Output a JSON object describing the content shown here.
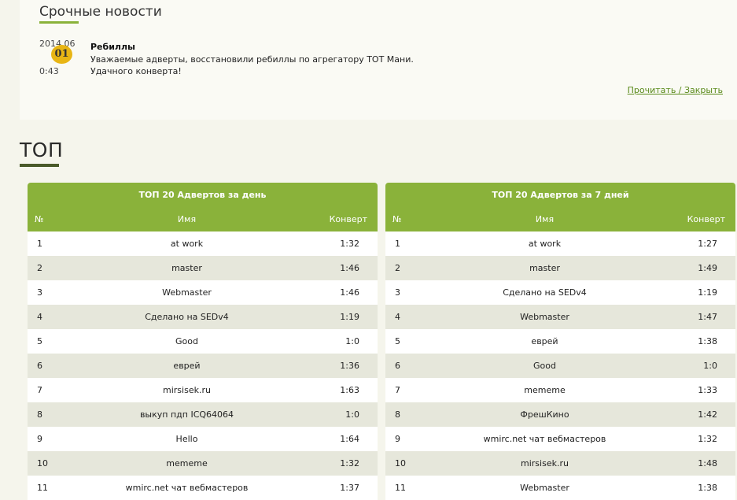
{
  "news": {
    "title": "Срочные новости",
    "date_top": "2014.06",
    "day": "01",
    "time": "0:43",
    "headline": "Ребиллы",
    "text_line1": "Уважаемые адверты, восстановили ребиллы по агрегатору ТОТ Мани.",
    "text_line2": "Удачного конверта!",
    "link": "Прочитать / Закрыть"
  },
  "top": {
    "title": "ТОП",
    "left": {
      "title": "ТОП 20 Адвертов за день",
      "col_num": "№",
      "col_name": "Имя",
      "col_conv": "Конверт",
      "rows": [
        {
          "n": "1",
          "name": "at work",
          "conv": "1:32"
        },
        {
          "n": "2",
          "name": "master",
          "conv": "1:46"
        },
        {
          "n": "3",
          "name": "Webmaster",
          "conv": "1:46"
        },
        {
          "n": "4",
          "name": "Сделано на SEDv4",
          "conv": "1:19"
        },
        {
          "n": "5",
          "name": "Good",
          "conv": "1:0"
        },
        {
          "n": "6",
          "name": "еврей",
          "conv": "1:36"
        },
        {
          "n": "7",
          "name": "mirsisek.ru",
          "conv": "1:63"
        },
        {
          "n": "8",
          "name": "выкуп пдп ICQ64064",
          "conv": "1:0"
        },
        {
          "n": "9",
          "name": "Hello",
          "conv": "1:64"
        },
        {
          "n": "10",
          "name": "mememe",
          "conv": "1:32"
        },
        {
          "n": "11",
          "name": "wmirc.net чат вебмастеров",
          "conv": "1:37"
        }
      ]
    },
    "right": {
      "title": "ТОП 20 Адвертов за 7 дней",
      "col_num": "№",
      "col_name": "Имя",
      "col_conv": "Конверт",
      "rows": [
        {
          "n": "1",
          "name": "at work",
          "conv": "1:27"
        },
        {
          "n": "2",
          "name": "master",
          "conv": "1:49"
        },
        {
          "n": "3",
          "name": "Сделано на SEDv4",
          "conv": "1:19"
        },
        {
          "n": "4",
          "name": "Webmaster",
          "conv": "1:47"
        },
        {
          "n": "5",
          "name": "еврей",
          "conv": "1:38"
        },
        {
          "n": "6",
          "name": "Good",
          "conv": "1:0"
        },
        {
          "n": "7",
          "name": "mememe",
          "conv": "1:33"
        },
        {
          "n": "8",
          "name": "ФрешКино",
          "conv": "1:42"
        },
        {
          "n": "9",
          "name": "wmirc.net чат вебмастеров",
          "conv": "1:32"
        },
        {
          "n": "10",
          "name": "mirsisek.ru",
          "conv": "1:48"
        },
        {
          "n": "11",
          "name": "Webmaster",
          "conv": "1:38"
        }
      ]
    }
  }
}
